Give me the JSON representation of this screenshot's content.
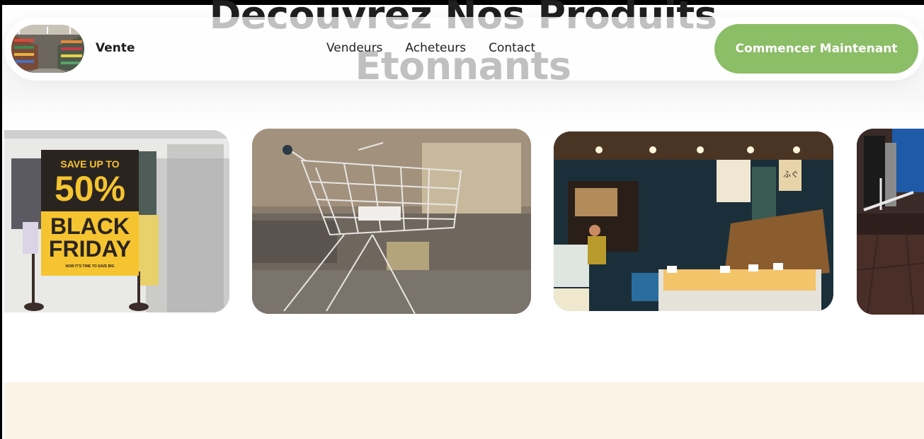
{
  "page": {
    "heading_line1": "Decouvrez Nos Produits",
    "heading_line2": "Etonnants"
  },
  "nav": {
    "logo_icon": "supermarket-aisle-photo",
    "brand": "Vente",
    "links": [
      "Vendeurs",
      "Acheteurs",
      "Contact"
    ],
    "cta_label": "Commencer Maintenant"
  },
  "gallery": {
    "items": [
      {
        "name": "black-friday-poster",
        "sign_line1": "SAVE UP TO",
        "sign_line2": "50%",
        "sign_line3": "BLACK",
        "sign_line4": "FRIDAY",
        "sign_line5": "NOW IT'S TIME TO SAVE BIG"
      },
      {
        "name": "abandoned-shopping-cart"
      },
      {
        "name": "japanese-market-stall",
        "stall_sign": "ふぐ"
      },
      {
        "name": "clothing-rack"
      }
    ]
  },
  "colors": {
    "cta": "#8cbd67",
    "poster_yellow": "#f5c430",
    "poster_dark": "#2a2421",
    "cream_section": "#fbf3e6"
  }
}
